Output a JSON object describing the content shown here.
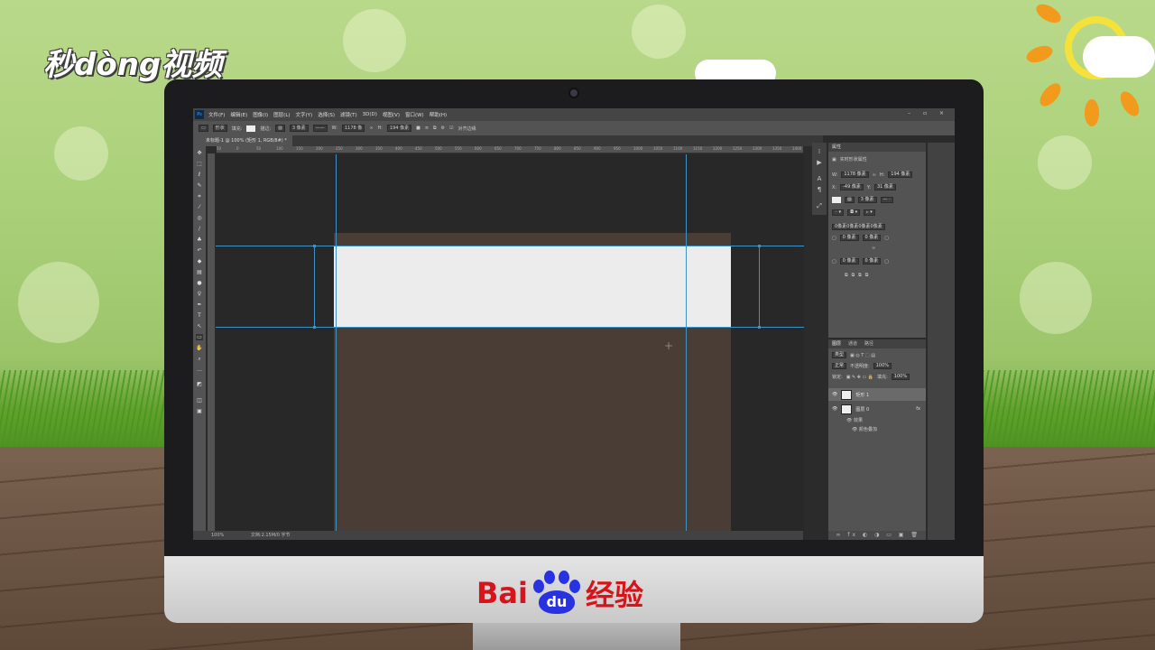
{
  "background": {
    "brand": "秒dòng视频",
    "footer_logo": {
      "left": "Bai",
      "paw": "du",
      "right": "经验"
    }
  },
  "app": {
    "logo": "Ps",
    "menu": [
      "文件(F)",
      "编辑(E)",
      "图像(I)",
      "图层(L)",
      "文字(Y)",
      "选择(S)",
      "滤镜(T)",
      "3D(D)",
      "视图(V)",
      "窗口(W)",
      "帮助(H)"
    ],
    "window_controls": "– ▫ ×",
    "options": {
      "mode": "形状",
      "fill_label": "填充:",
      "stroke_label": "描边:",
      "stroke_width": "3 像素",
      "w_label": "W:",
      "w_value": "1178 像",
      "h_label": "H:",
      "h_value": "194 像素",
      "align_edges": "对齐边缘"
    },
    "document_tab": "未标题-1 @ 100% (矩形 1, RGB/8#) *",
    "ruler_ticks": [
      "50",
      "0",
      "50",
      "100",
      "150",
      "200",
      "250",
      "300",
      "350",
      "400",
      "450",
      "500",
      "550",
      "600",
      "650",
      "700",
      "750",
      "800",
      "850",
      "900",
      "950",
      "1000",
      "1050",
      "1100",
      "1150",
      "1200",
      "1250",
      "1300",
      "1350",
      "1400"
    ],
    "status": {
      "zoom": "100%",
      "doc": "文档:2.15M/0 字节"
    },
    "properties": {
      "title": "属性",
      "subtitle": "实时形状属性",
      "w_label": "W:",
      "w": "1178 像素",
      "h_label": "H:",
      "h": "194 像素",
      "x_label": "X:",
      "x": "-49 像素",
      "y_label": "Y:",
      "y": "31 像素",
      "stroke": "3 像素",
      "corner_all": "0像素0像素0像素0像素",
      "corner_tl": "0 像素",
      "corner_tr": "0 像素",
      "corner_bl": "0 像素",
      "corner_br": "0 像素"
    },
    "layers": {
      "tabs": [
        "图层",
        "通道",
        "路径"
      ],
      "kind": "类型",
      "blend": "正常",
      "opacity_label": "不透明度:",
      "opacity": "100%",
      "lock_label": "锁定:",
      "fill_label": "填充:",
      "fill": "100%",
      "items": [
        {
          "name": "矩形 1",
          "fx": ""
        },
        {
          "name": "图层 0",
          "fx": "fx"
        }
      ],
      "effects_label": "效果",
      "effect_item": "颜色叠加"
    }
  },
  "colors": {
    "canvas": "#4a3d35",
    "shape": "#ececec",
    "guide": "#3b93c8"
  }
}
